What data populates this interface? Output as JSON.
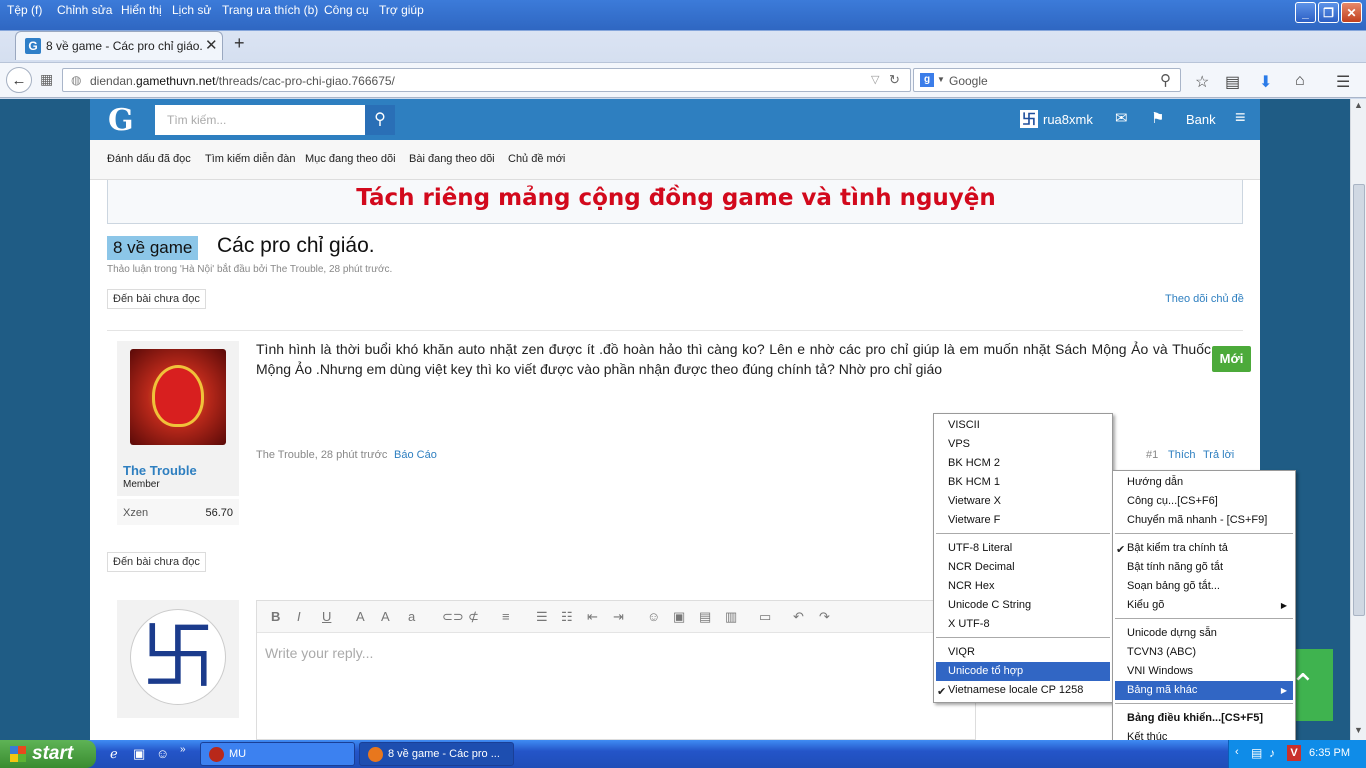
{
  "browser": {
    "menu": [
      "Tệp (f)",
      "Chỉnh sửa",
      "Hiển thị",
      "Lịch sử",
      "Trang ưa thích (b)",
      "Công cụ",
      "Trợ giúp"
    ],
    "tab_title": "8 về game - Các pro chỉ giáo. ...",
    "tab_favicon": "G",
    "url_host": "diendan.gamethuvn.net",
    "url_path": "/threads/cac-pro-chi-giao.766675/",
    "url_prefix": "diendan.",
    "url_domain": "gamethuvn.net",
    "search_engine_letter": "g",
    "search_placeholder": "Google"
  },
  "site": {
    "logo": "G",
    "search_placeholder": "Tìm kiếm...",
    "username": "rua8xmk",
    "bank_label": "Bank",
    "subnav": [
      "Đánh dấu đã đọc",
      "Tìm kiếm diễn đàn",
      "Mục đang theo dõi",
      "Bài đang theo dõi",
      "Chủ đề mới"
    ]
  },
  "notice": "Tách riêng mảng cộng đồng game và tình nguyện",
  "thread": {
    "prefix": "8 về game",
    "title": "Các pro chỉ giáo.",
    "meta": "Thảo luận trong 'Hà Nội' bắt đầu bởi The Trouble, 28 phút trước.",
    "unread_button": "Đến bài chưa đọc",
    "follow_link": "Theo dõi chủ đề"
  },
  "post": {
    "poster_name": "The Trouble",
    "poster_role": "Member",
    "stat_label": "Xzen",
    "stat_value": "56.70",
    "body": "Tình hình là thời buổi khó khăn auto nhặt zen được ít .đồ hoàn hảo thì càng ko? Lên e nhờ các pro chỉ giúp là em muốn nhặt Sách Mộng Ảo và Thuốc Mộng Ảo .Nhưng em dùng việt key thì ko viết được vào phần nhận được theo đúng chính tả? Nhờ pro chỉ giáo",
    "new_badge": "Mới",
    "meta": "The Trouble, 28 phút trước",
    "report": "Báo Cáo",
    "number": "#1",
    "like": "Thích",
    "reply": "Trả lời"
  },
  "reply_box": {
    "placeholder": "Write your reply..."
  },
  "encoding_menu": {
    "items": [
      {
        "label": "VISCII"
      },
      {
        "label": "VPS"
      },
      {
        "label": "BK HCM 2"
      },
      {
        "label": "BK HCM 1"
      },
      {
        "label": "Vietware X"
      },
      {
        "label": "Vietware F"
      },
      {
        "label": "UTF-8 Literal"
      },
      {
        "label": "NCR Decimal"
      },
      {
        "label": "NCR Hex"
      },
      {
        "label": "Unicode C String"
      },
      {
        "label": "X UTF-8"
      },
      {
        "label": "VIQR"
      },
      {
        "label": "Unicode tổ hợp"
      },
      {
        "label": "Vietnamese locale CP 1258"
      }
    ],
    "selected": "Unicode tổ hợp",
    "checked": "Vietnamese locale CP 1258"
  },
  "unikey_menu": {
    "items": [
      {
        "label": "Hướng dẫn"
      },
      {
        "label": "Công cụ...[CS+F6]"
      },
      {
        "label": "Chuyển mã nhanh - [CS+F9]"
      },
      {
        "label": "Bật kiểm tra chính tả"
      },
      {
        "label": "Bật tính năng gõ tắt"
      },
      {
        "label": "Soạn bảng gõ tắt..."
      },
      {
        "label": "Kiểu gõ"
      },
      {
        "label": "Unicode dựng sẵn"
      },
      {
        "label": "TCVN3 (ABC)"
      },
      {
        "label": "VNI Windows"
      },
      {
        "label": "Bảng mã khác"
      },
      {
        "label": "Bảng điều khiển...[CS+F5]"
      },
      {
        "label": "Kết thúc"
      }
    ],
    "checked": "Bật kiểm tra chính tả",
    "selected": "Bảng mã khác"
  },
  "taskbar": {
    "start": "start",
    "tasks": [
      {
        "label": "MU"
      },
      {
        "label": "8 về game - Các pro ..."
      }
    ],
    "clock": "6:35 PM"
  },
  "colors": {
    "site_blue": "#2e7fc0",
    "notice_red": "#d2091c",
    "menu_highlight": "#3166c4",
    "new_badge": "#4caa3a"
  }
}
